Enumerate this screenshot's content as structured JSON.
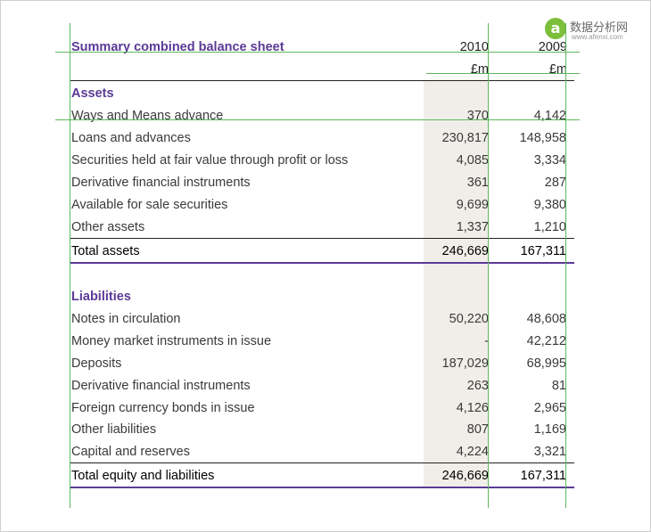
{
  "logo": {
    "mark": "a",
    "chinese": "数据分析网",
    "domain": "www.afenxi.com"
  },
  "title": "Summary combined balance sheet",
  "columns": {
    "year1": "2010",
    "year2": "2009",
    "unit1": "£m",
    "unit2": "£m"
  },
  "assets": {
    "heading": "Assets",
    "rows": [
      {
        "label": "Ways and Means advance",
        "v2010": "370",
        "v2009": "4,142"
      },
      {
        "label": "Loans and advances",
        "v2010": "230,817",
        "v2009": "148,958"
      },
      {
        "label": "Securities held at fair value through profit or loss",
        "v2010": "4,085",
        "v2009": "3,334"
      },
      {
        "label": "Derivative financial instruments",
        "v2010": "361",
        "v2009": "287"
      },
      {
        "label": "Available for sale securities",
        "v2010": "9,699",
        "v2009": "9,380"
      },
      {
        "label": "Other assets",
        "v2010": "1,337",
        "v2009": "1,210"
      }
    ],
    "total": {
      "label": "Total assets",
      "v2010": "246,669",
      "v2009": "167,311"
    }
  },
  "liabilities": {
    "heading": "Liabilities",
    "rows": [
      {
        "label": "Notes in circulation",
        "v2010": "50,220",
        "v2009": "48,608"
      },
      {
        "label": "Money market instruments in issue",
        "v2010": "-",
        "v2009": "42,212"
      },
      {
        "label": "Deposits",
        "v2010": "187,029",
        "v2009": "68,995"
      },
      {
        "label": "Derivative financial instruments",
        "v2010": "263",
        "v2009": "81"
      },
      {
        "label": "Foreign currency bonds in issue",
        "v2010": "4,126",
        "v2009": "2,965"
      },
      {
        "label": "Other liabilities",
        "v2010": "807",
        "v2009": "1,169"
      },
      {
        "label": "Capital and reserves",
        "v2010": "4,224",
        "v2009": "3,321"
      }
    ],
    "total": {
      "label": "Total equity and liabilities",
      "v2010": "246,669",
      "v2009": "167,311"
    }
  }
}
